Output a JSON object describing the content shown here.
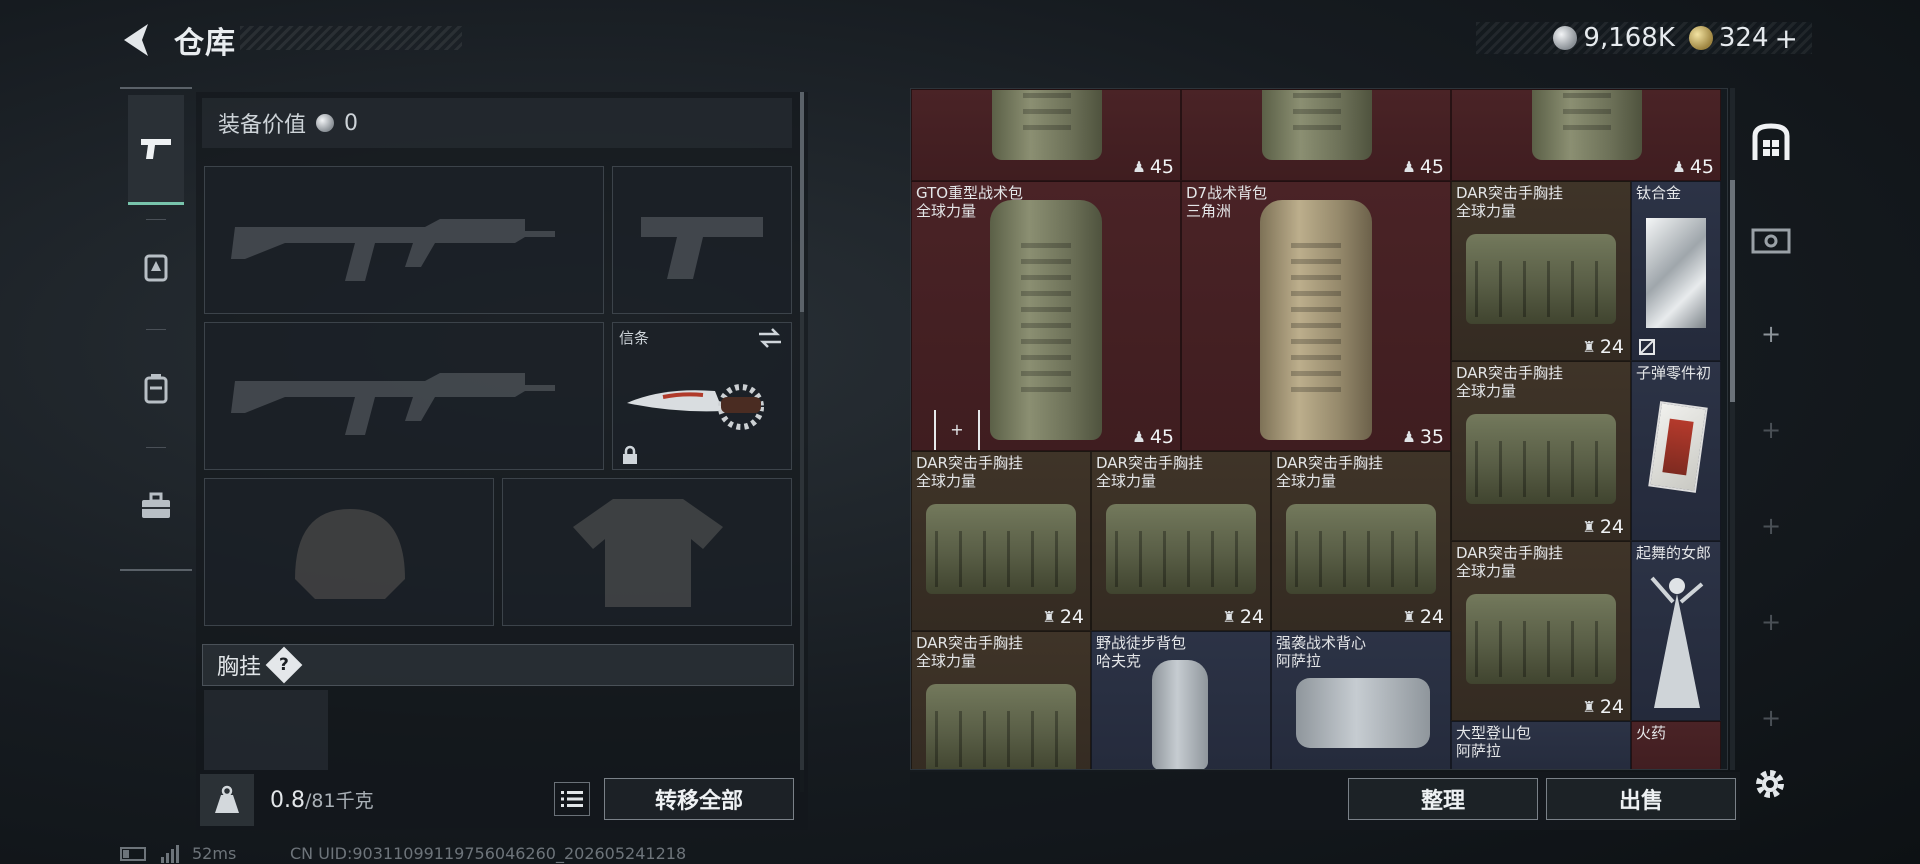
{
  "header": {
    "title": "仓库",
    "currency": [
      {
        "icon": "silver-coin-icon",
        "value": "9,168K"
      },
      {
        "icon": "gold-coin-icon",
        "value": "324"
      }
    ],
    "plus": "+"
  },
  "left_panel": {
    "equip_value_label": "装备价值",
    "equip_value": "0",
    "melee_slot_label": "信条",
    "chest_label": "胸挂",
    "help": "?",
    "weight_current": "0.8",
    "weight_max": "/81千克",
    "transfer_all": "转移全部"
  },
  "grid": {
    "items": [
      {
        "name": "",
        "sub": "",
        "dura": "45"
      },
      {
        "name": "",
        "sub": "",
        "dura": "45"
      },
      {
        "name": "",
        "sub": "",
        "dura": "45"
      },
      {
        "name": "GTO重型战术包",
        "sub": "全球力量",
        "dura": "45"
      },
      {
        "name": "D7战术背包",
        "sub": "三角洲",
        "dura": "35"
      },
      {
        "name": "DAR突击手胸挂",
        "sub": "全球力量",
        "dura": "24"
      },
      {
        "name": "钛合金",
        "sub": ""
      },
      {
        "name": "DAR突击手胸挂",
        "sub": "全球力量",
        "dura": "24"
      },
      {
        "name": "子弹零件初",
        "sub": ""
      },
      {
        "name": "DAR突击手胸挂",
        "sub": "全球力量",
        "dura": "24"
      },
      {
        "name": "DAR突击手胸挂",
        "sub": "全球力量",
        "dura": "24"
      },
      {
        "name": "DAR突击手胸挂",
        "sub": "全球力量",
        "dura": "24"
      },
      {
        "name": "DAR突击手胸挂",
        "sub": "全球力量",
        "dura": "24"
      },
      {
        "name": "起舞的女郎",
        "sub": ""
      },
      {
        "name": "DAR突击手胸挂",
        "sub": "全球力量"
      },
      {
        "name": "野战徒步背包",
        "sub": "哈夫克"
      },
      {
        "name": "强袭战术背心",
        "sub": "阿萨拉"
      },
      {
        "name": "大型登山包",
        "sub": "阿萨拉"
      },
      {
        "name": "火药",
        "sub": ""
      }
    ]
  },
  "buttons": {
    "sort": "整理",
    "sell": "出售"
  },
  "footer": {
    "ping": "52ms",
    "uid": "CN UID:9031109911975604626​0_202605241218"
  }
}
